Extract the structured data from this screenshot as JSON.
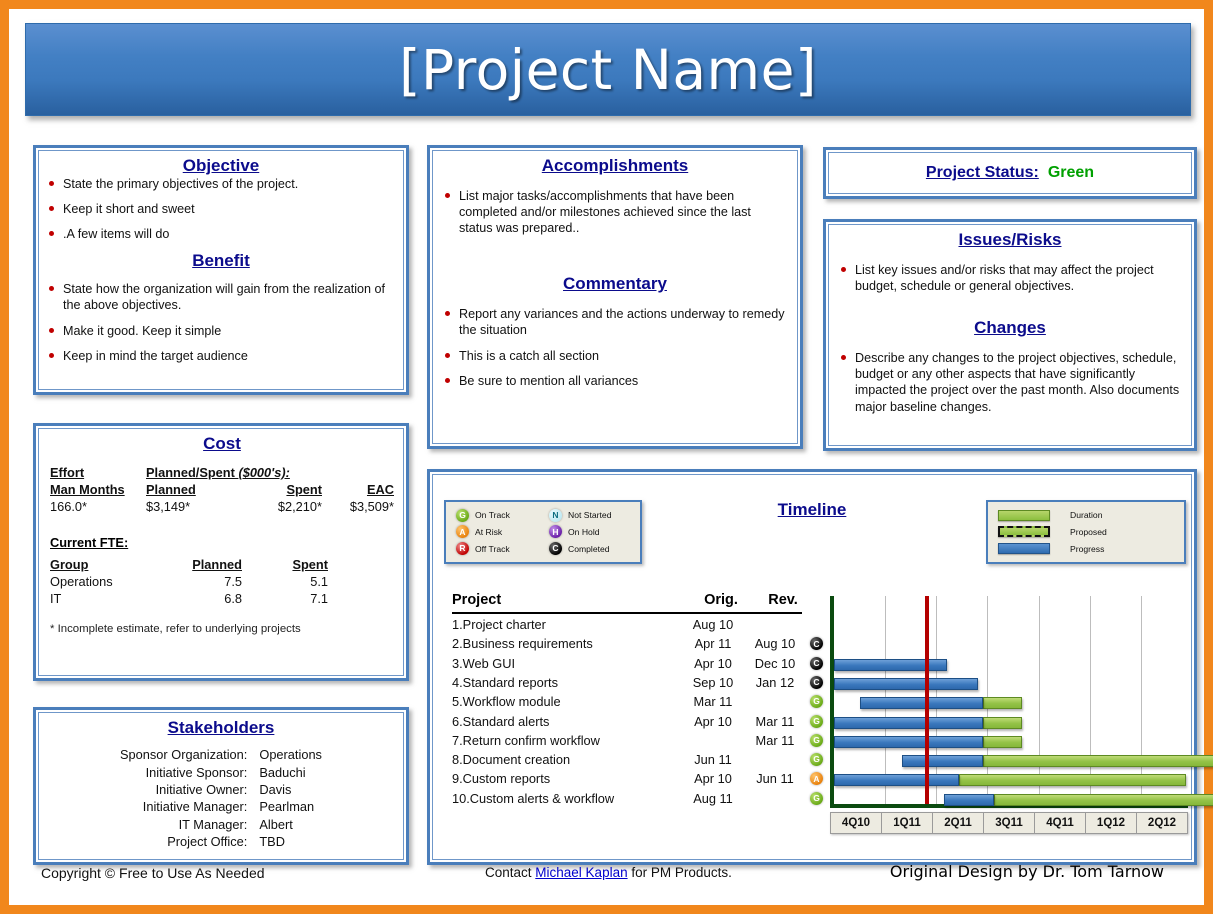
{
  "header": {
    "title": "[Project Name]"
  },
  "objective": {
    "heading": "Objective",
    "bullets": [
      "State the primary objectives of the project.",
      "Keep it short and sweet",
      ".A few items will do"
    ],
    "benefit_heading": "Benefit",
    "benefit_bullets": [
      "State how the organization will gain from the realization of the above objectives.",
      "Make it good. Keep it simple",
      "Keep in mind the target audience"
    ]
  },
  "cost": {
    "heading": "Cost",
    "effort_label": "Effort",
    "planned_spent_label": "Planned/Spent ",
    "planned_spent_units": "($000's):",
    "col_man_months": "Man Months",
    "col_planned": "Planned",
    "col_spent": "Spent",
    "col_eac": "EAC",
    "man_months": "166.0*",
    "planned": "$3,149*",
    "spent": "$2,210*",
    "eac": "$3,509*",
    "fte_heading": "Current FTE:",
    "fte_col_group": "Group",
    "fte_col_planned": "Planned",
    "fte_col_spent": "Spent",
    "fte_rows": [
      {
        "group": "Operations",
        "planned": "7.5",
        "spent": "5.1"
      },
      {
        "group": "IT",
        "planned": "6.8",
        "spent": "7.1"
      }
    ],
    "note": "*  Incomplete estimate, refer to underlying projects"
  },
  "stakeholders": {
    "heading": "Stakeholders",
    "rows": [
      {
        "label": "Sponsor Organization:",
        "value": "Operations"
      },
      {
        "label": "Initiative Sponsor:",
        "value": "Baduchi"
      },
      {
        "label": "Initiative Owner:",
        "value": "Davis"
      },
      {
        "label": "Initiative Manager:",
        "value": "Pearlman"
      },
      {
        "label": "IT Manager:",
        "value": "Albert"
      },
      {
        "label": "Project Office:",
        "value": "TBD"
      }
    ]
  },
  "accomplishments": {
    "heading": "Accomplishments",
    "bullets": [
      "List major tasks/accomplishments that have been completed and/or milestones achieved since the last status was prepared.."
    ],
    "commentary_heading": "Commentary",
    "commentary_bullets": [
      "Report any variances and the actions underway to remedy the situation",
      "This is a catch all section",
      "Be sure to mention all variances"
    ]
  },
  "status": {
    "label": "Project Status:",
    "value": "Green",
    "value_color": "#00A000"
  },
  "issues": {
    "heading": "Issues/Risks",
    "bullets": [
      "List key issues and/or risks that may affect the project budget, schedule or general objectives."
    ],
    "changes_heading": "Changes",
    "changes_bullets": [
      "Describe any changes to the project objectives, schedule, budget or any other aspects that have significantly impacted the project over the past month. Also documents major baseline changes."
    ]
  },
  "timeline": {
    "heading": "Timeline",
    "status_legend": [
      {
        "code": "G",
        "cls": "g",
        "label": "On Track"
      },
      {
        "code": "N",
        "cls": "n",
        "label": "Not Started"
      },
      {
        "code": "A",
        "cls": "a",
        "label": "At Risk"
      },
      {
        "code": "H",
        "cls": "h",
        "label": "On Hold"
      },
      {
        "code": "R",
        "cls": "r",
        "label": "Off Track"
      },
      {
        "code": "C",
        "cls": "c",
        "label": "Completed"
      }
    ],
    "bar_legend": [
      {
        "label": "Duration",
        "cls": "sw-duration"
      },
      {
        "label": "Proposed",
        "cls": "sw-proposed"
      },
      {
        "label": "Progress",
        "cls": "sw-progress"
      }
    ],
    "columns": {
      "project": "Project",
      "orig": "Orig.",
      "rev": "Rev."
    },
    "quarters": [
      "4Q10",
      "1Q11",
      "2Q11",
      "3Q11",
      "4Q11",
      "1Q12",
      "2Q12"
    ],
    "today_marker_pct": 25.5,
    "colors": {
      "progress": "#3a78bd",
      "duration": "#93c246",
      "today": "#B40000",
      "axis": "#0B4B10"
    },
    "rows": [
      {
        "name": "1.Project charter",
        "orig": "Aug 10",
        "rev": "",
        "rag": "",
        "rag_cls": "",
        "blue": null,
        "green": null
      },
      {
        "name": "2.Business requirements",
        "orig": "Apr 11",
        "rev": "Aug 10",
        "rag": "C",
        "rag_cls": "c",
        "blue": null,
        "green": null
      },
      {
        "name": "3.Web GUI",
        "orig": "Apr 10",
        "rev": "Dec 10",
        "rag": "C",
        "rag_cls": "c",
        "blue": {
          "start": 0.0,
          "end": 55.0
        },
        "green": null
      },
      {
        "name": "4.Standard reports",
        "orig": "Sep 10",
        "rev": "Jan 12",
        "rag": "C",
        "rag_cls": "c",
        "blue": {
          "start": 0.0,
          "end": 70.5
        },
        "green": null
      },
      {
        "name": "5.Workflow module",
        "orig": "Mar 11",
        "rev": "",
        "rag": "G",
        "rag_cls": "g",
        "blue": {
          "start": 12.5,
          "end": 73.0
        },
        "green": {
          "start": 73.0,
          "end": 92.0
        }
      },
      {
        "name": "6.Standard alerts",
        "orig": "Apr 10",
        "rev": "Mar 11",
        "rag": "G",
        "rag_cls": "g",
        "blue": {
          "start": 0.0,
          "end": 73.0
        },
        "green": {
          "start": 73.0,
          "end": 92.0
        }
      },
      {
        "name": "7.Return confirm workflow",
        "orig": "",
        "rev": "Mar 11",
        "rag": "G",
        "rag_cls": "g",
        "blue": {
          "start": 0.0,
          "end": 73.0
        },
        "green": {
          "start": 73.0,
          "end": 92.0
        }
      },
      {
        "name": "8.Document creation",
        "orig": "Jun 11",
        "rev": "",
        "rag": "G",
        "rag_cls": "g",
        "blue": {
          "start": 33.0,
          "end": 73.0
        },
        "green": {
          "start": 73.0,
          "end": 200.0
        }
      },
      {
        "name": "9.Custom reports",
        "orig": "Apr 10",
        "rev": "Jun 11",
        "rag": "A",
        "rag_cls": "a",
        "blue": {
          "start": 0.0,
          "end": 61.0
        },
        "green": {
          "start": 61.0,
          "end": 172.0
        }
      },
      {
        "name": "10.Custom alerts & workflow",
        "orig": "Aug 11",
        "rev": "",
        "rag": "G",
        "rag_cls": "g",
        "blue": {
          "start": 54.0,
          "end": 78.0
        },
        "green": {
          "start": 78.0,
          "end": 228.0
        }
      }
    ]
  },
  "footer": {
    "copyright": "Copyright © Free to Use As Needed",
    "contact_pre": "Contact ",
    "contact_link": "Michael Kaplan",
    "contact_post": " for PM Products.",
    "design": "Original Design by Dr. Tom Tarnow"
  }
}
